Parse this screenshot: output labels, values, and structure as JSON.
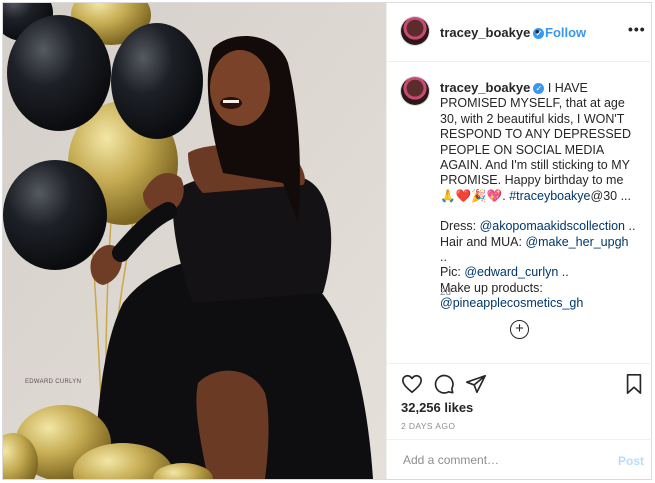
{
  "photo": {
    "description_icon": "photo-of-woman-with-balloons",
    "watermark": "EDWARD CURLYN"
  },
  "header": {
    "username": "tracey_boakye",
    "verified_icon": "verified-badge-icon",
    "separator": "•",
    "follow_label": "Follow",
    "more_label": "•••"
  },
  "caption": {
    "username": "tracey_boakye",
    "text1": " I HAVE PROMISED MYSELF, that at age 30, with 2 beautiful kids, I WON'T RESPOND TO ANY DEPRESSED PEOPLE ON SOCIAL MEDIA AGAIN. And I'm still sticking to MY PROMISE. Happy birthday to me 🙏❤️🎉💖. ",
    "hashtag": "#traceyboakye",
    "text2": "@30 ...",
    "dress_label": "Dress: ",
    "dress_handle": "@akopomaakidscollection",
    "dress_tail": " ..",
    "hair_label": "Hair and MUA: ",
    "hair_handle": "@make_her_upgh",
    "hair_tail": " ..",
    "pic_label": "Pic: ",
    "pic_handle": "@edward_curlyn",
    "pic_tail": " ..",
    "makeup_label": "Make up products:",
    "makeup_handle": "@pineapplecosmetics_gh",
    "age": "2d"
  },
  "load_more_icon": "plus-circle-icon",
  "actions": {
    "icons": [
      "heart-icon",
      "comment-icon",
      "share-icon",
      "bookmark-icon"
    ],
    "likes": "32,256 likes",
    "date": "2 DAYS AGO"
  },
  "comment_box": {
    "placeholder": "Add a comment…",
    "post_label": "Post"
  },
  "colors": {
    "link": "#00376b",
    "follow": "#3897f0",
    "post_disabled": "#b2dffc",
    "muted": "#8e8e8e"
  }
}
